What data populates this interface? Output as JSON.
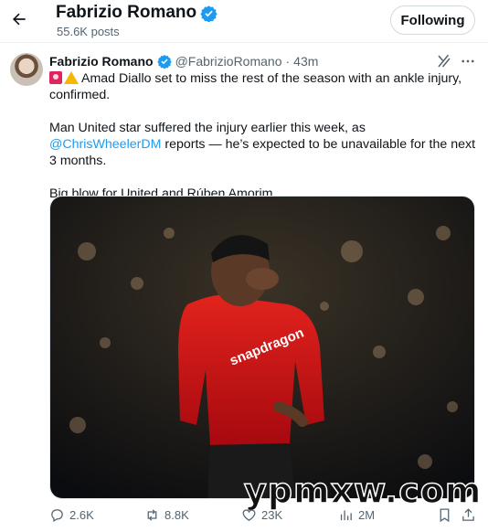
{
  "header": {
    "profile_name": "Fabrizio Romano",
    "post_count": "55.6K posts",
    "follow_label": "Following"
  },
  "tweet": {
    "author_name": "Fabrizio Romano",
    "handle": "@FabrizioRomano",
    "separator": "·",
    "time": "43m",
    "emoji": [
      "siren-emoji",
      "warning-emoji"
    ],
    "line1": "Amad Diallo set to miss the rest of the season with an ankle injury, confirmed.",
    "line2_before": "Man United star suffered the injury earlier this week, as ",
    "line2_mention": "@ChrisWheelerDM",
    "line2_after": " reports — he’s expected to be unavailable for the next 3 months.",
    "line3": "Big blow for United and Rúben Amorim."
  },
  "media": {
    "description_icon": "photo",
    "shirt_sponsor": "snapdragon",
    "player_number": ""
  },
  "actions": {
    "replies": "2.6K",
    "reposts": "8.8K",
    "likes": "23K",
    "views": "2M"
  },
  "watermark": "ypmxw.com",
  "colors": {
    "accent": "#1d9bf0",
    "text": "#0f1419",
    "secondary": "#536471",
    "verified": "#1d9bf0",
    "kit_red": "#d4161c"
  }
}
